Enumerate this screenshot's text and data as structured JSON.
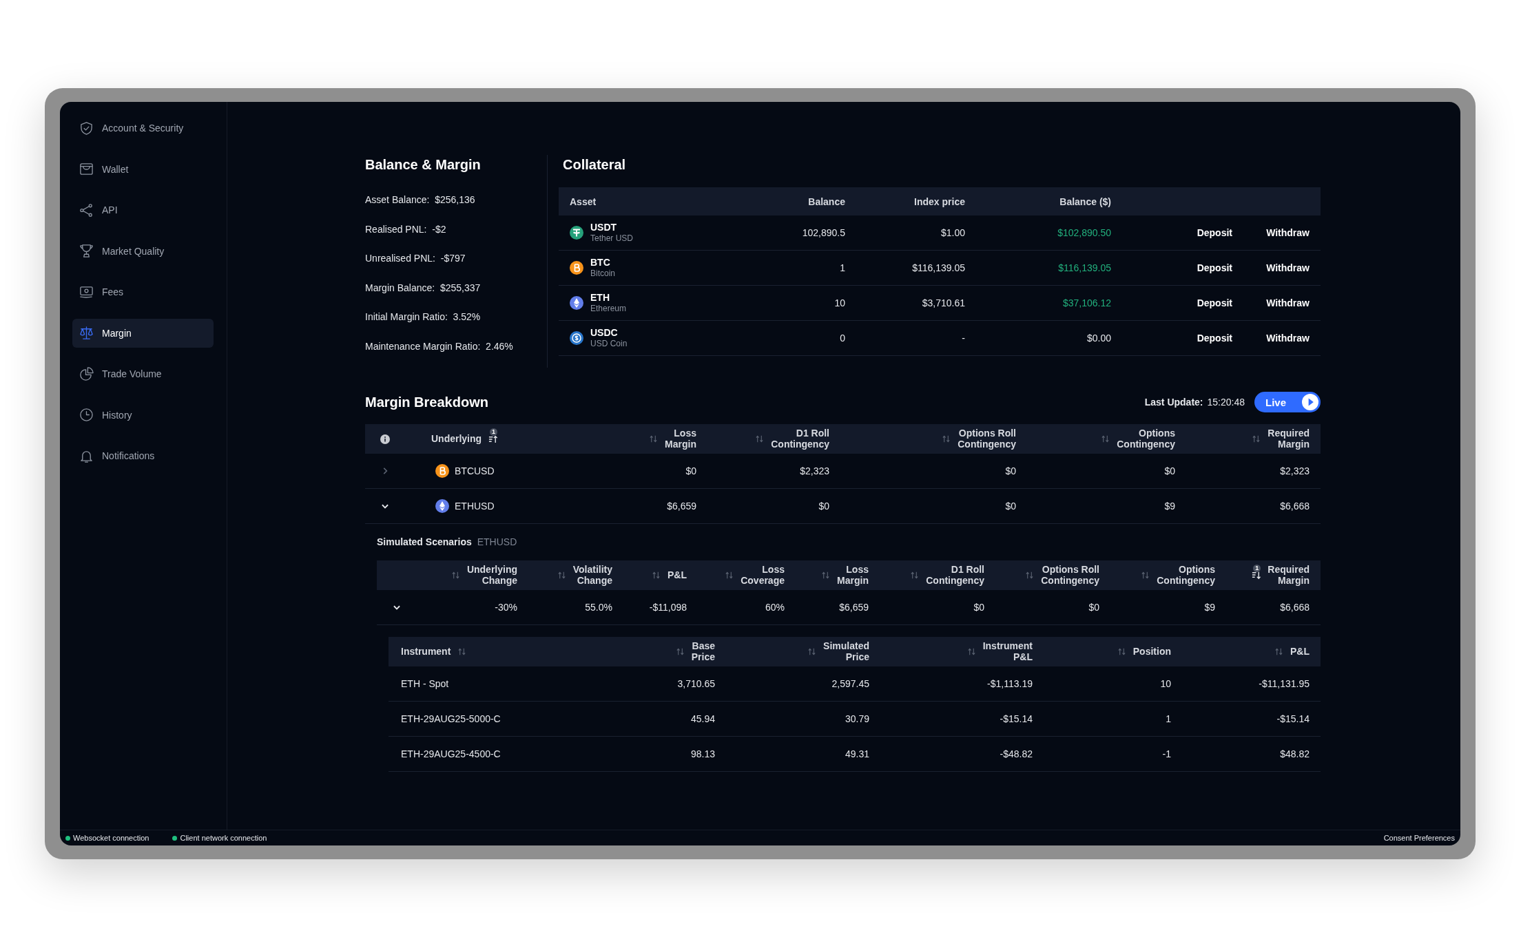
{
  "sidebar": {
    "items": [
      {
        "label": "Account & Security",
        "selected": false
      },
      {
        "label": "Wallet",
        "selected": false
      },
      {
        "label": "API",
        "selected": false
      },
      {
        "label": "Market Quality",
        "selected": false
      },
      {
        "label": "Fees",
        "selected": false
      },
      {
        "label": "Margin",
        "selected": true
      },
      {
        "label": "Trade Volume",
        "selected": false
      },
      {
        "label": "History",
        "selected": false
      },
      {
        "label": "Notifications",
        "selected": false
      }
    ]
  },
  "balance_margin": {
    "title": "Balance & Margin",
    "items": [
      {
        "label": "Asset Balance:",
        "value": "$256,136"
      },
      {
        "label": "Realised PNL:",
        "value": "-$2"
      },
      {
        "label": "Unrealised PNL:",
        "value": "-$797"
      },
      {
        "label": "Margin Balance:",
        "value": "$255,337"
      },
      {
        "label": "Initial Margin Ratio:",
        "value": "3.52%"
      },
      {
        "label": "Maintenance Margin Ratio:",
        "value": "2.46%"
      }
    ]
  },
  "collateral": {
    "title": "Collateral",
    "columns": [
      "Asset",
      "Balance",
      "Index price",
      "Balance ($)"
    ],
    "rows": [
      {
        "symbol": "USDT",
        "name": "Tether USD",
        "color": "#26a17b",
        "balance": "102,890.5",
        "index_price": "$1.00",
        "balance_usd": "$102,890.50",
        "positive": true,
        "deposit": "Deposit",
        "withdraw": "Withdraw"
      },
      {
        "symbol": "BTC",
        "name": "Bitcoin",
        "color": "#f7931a",
        "balance": "1",
        "index_price": "$116,139.05",
        "balance_usd": "$116,139.05",
        "positive": true,
        "deposit": "Deposit",
        "withdraw": "Withdraw"
      },
      {
        "symbol": "ETH",
        "name": "Ethereum",
        "color": "#627eea",
        "balance": "10",
        "index_price": "$3,710.61",
        "balance_usd": "$37,106.12",
        "positive": true,
        "deposit": "Deposit",
        "withdraw": "Withdraw"
      },
      {
        "symbol": "USDC",
        "name": "USD Coin",
        "color": "#2775ca",
        "balance": "0",
        "index_price": "-",
        "balance_usd": "$0.00",
        "positive": false,
        "deposit": "Deposit",
        "withdraw": "Withdraw"
      }
    ]
  },
  "margin_breakdown": {
    "title": "Margin Breakdown",
    "last_update_label": "Last Update:",
    "last_update": "15:20:48",
    "live": {
      "label": "Live",
      "on": true
    },
    "columns": [
      {
        "label": "Underlying",
        "sorted": true,
        "descending": false,
        "sort_rank": "1"
      },
      {
        "label": "Loss\nMargin",
        "sorted": false
      },
      {
        "label": "D1 Roll\nContingency",
        "sorted": false
      },
      {
        "label": "Options Roll\nContingency",
        "sorted": false
      },
      {
        "label": "Options\nContingency",
        "sorted": false
      },
      {
        "label": "Required\nMargin",
        "sorted": false
      }
    ],
    "rows": [
      {
        "expanded": false,
        "underlying": "BTCUSD",
        "color": "#f7931a",
        "values": [
          "$0",
          "$2,323",
          "$0",
          "$0",
          "$2,323"
        ]
      },
      {
        "expanded": true,
        "underlying": "ETHUSD",
        "color": "#627eea",
        "values": [
          "$6,659",
          "$0",
          "$0",
          "$9",
          "$6,668"
        ]
      }
    ]
  },
  "simulated_scenarios": {
    "title": "Simulated Scenarios",
    "underlying": "ETHUSD",
    "columns": [
      {
        "label": "Underlying\nChange",
        "sorted": false
      },
      {
        "label": "Volatility\nChange",
        "sorted": false
      },
      {
        "label": "P&L",
        "sorted": false
      },
      {
        "label": "Loss\nCoverage",
        "sorted": false
      },
      {
        "label": "Loss\nMargin",
        "sorted": false
      },
      {
        "label": "D1 Roll\nContingency",
        "sorted": false
      },
      {
        "label": "Options Roll\nContingency",
        "sorted": false
      },
      {
        "label": "Options\nContingency",
        "sorted": false
      },
      {
        "label": "Required\nMargin",
        "sorted": true,
        "descending": true,
        "sort_rank": "1"
      }
    ],
    "rows": [
      {
        "expanded": true,
        "values": [
          "-30%",
          "55.0%",
          "-$11,098",
          "60%",
          "$6,659",
          "$0",
          "$0",
          "$9",
          "$6,668"
        ]
      }
    ],
    "instruments": {
      "columns": [
        {
          "label": "Instrument",
          "sorted": false
        },
        {
          "label": "Base\nPrice",
          "sorted": false
        },
        {
          "label": "Simulated\nPrice",
          "sorted": false
        },
        {
          "label": "Instrument\nP&L",
          "sorted": false
        },
        {
          "label": "Position",
          "sorted": false
        },
        {
          "label": "P&L",
          "sorted": false
        }
      ],
      "rows": [
        {
          "cells": [
            "ETH - Spot",
            "3,710.65",
            "2,597.45",
            "-$1,113.19",
            "10",
            "-$11,131.95"
          ]
        },
        {
          "cells": [
            "ETH-29AUG25-5000-C",
            "45.94",
            "30.79",
            "-$15.14",
            "1",
            "-$15.14"
          ]
        },
        {
          "cells": [
            "ETH-29AUG25-4500-C",
            "98.13",
            "49.31",
            "-$48.82",
            "-1",
            "$48.82"
          ]
        }
      ]
    }
  },
  "status_bar": {
    "items": [
      {
        "label": "Websocket connection",
        "connected": true
      },
      {
        "label": "Client network connection",
        "connected": true
      }
    ],
    "link": "Consent Preferences"
  }
}
